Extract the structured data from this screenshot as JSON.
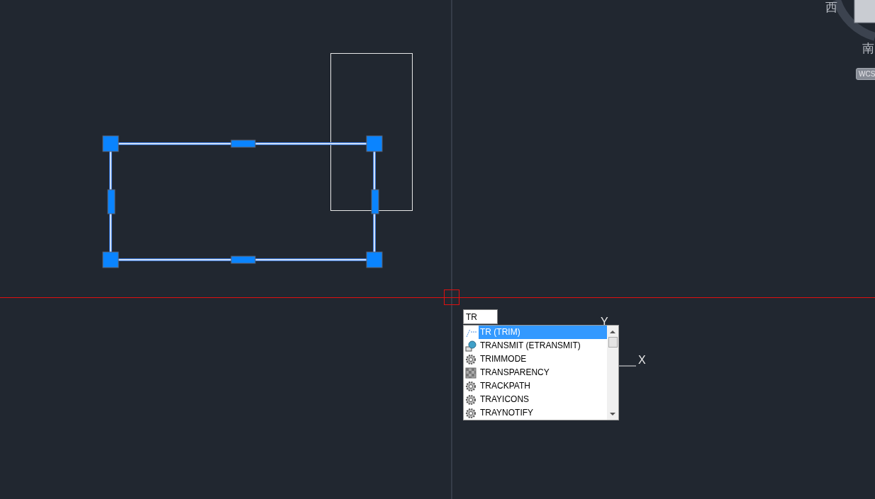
{
  "viewcube": {
    "west": "西",
    "south": "南",
    "wcs": "WCS"
  },
  "command_input": {
    "value": "TR"
  },
  "autocomplete": [
    {
      "label": "TR (TRIM)",
      "kind": "line",
      "selected": true
    },
    {
      "label": "TRANSMIT (ETRANSMIT)",
      "kind": "transmit",
      "selected": false
    },
    {
      "label": "TRIMMODE",
      "kind": "setting",
      "selected": false
    },
    {
      "label": "TRANSPARENCY",
      "kind": "pattern",
      "selected": false
    },
    {
      "label": "TRACKPATH",
      "kind": "setting",
      "selected": false
    },
    {
      "label": "TRAYICONS",
      "kind": "setting",
      "selected": false
    },
    {
      "label": "TRAYNOTIFY",
      "kind": "setting",
      "selected": false
    }
  ],
  "ucs_icon": {
    "y_label": "Y",
    "x_label": "X"
  }
}
